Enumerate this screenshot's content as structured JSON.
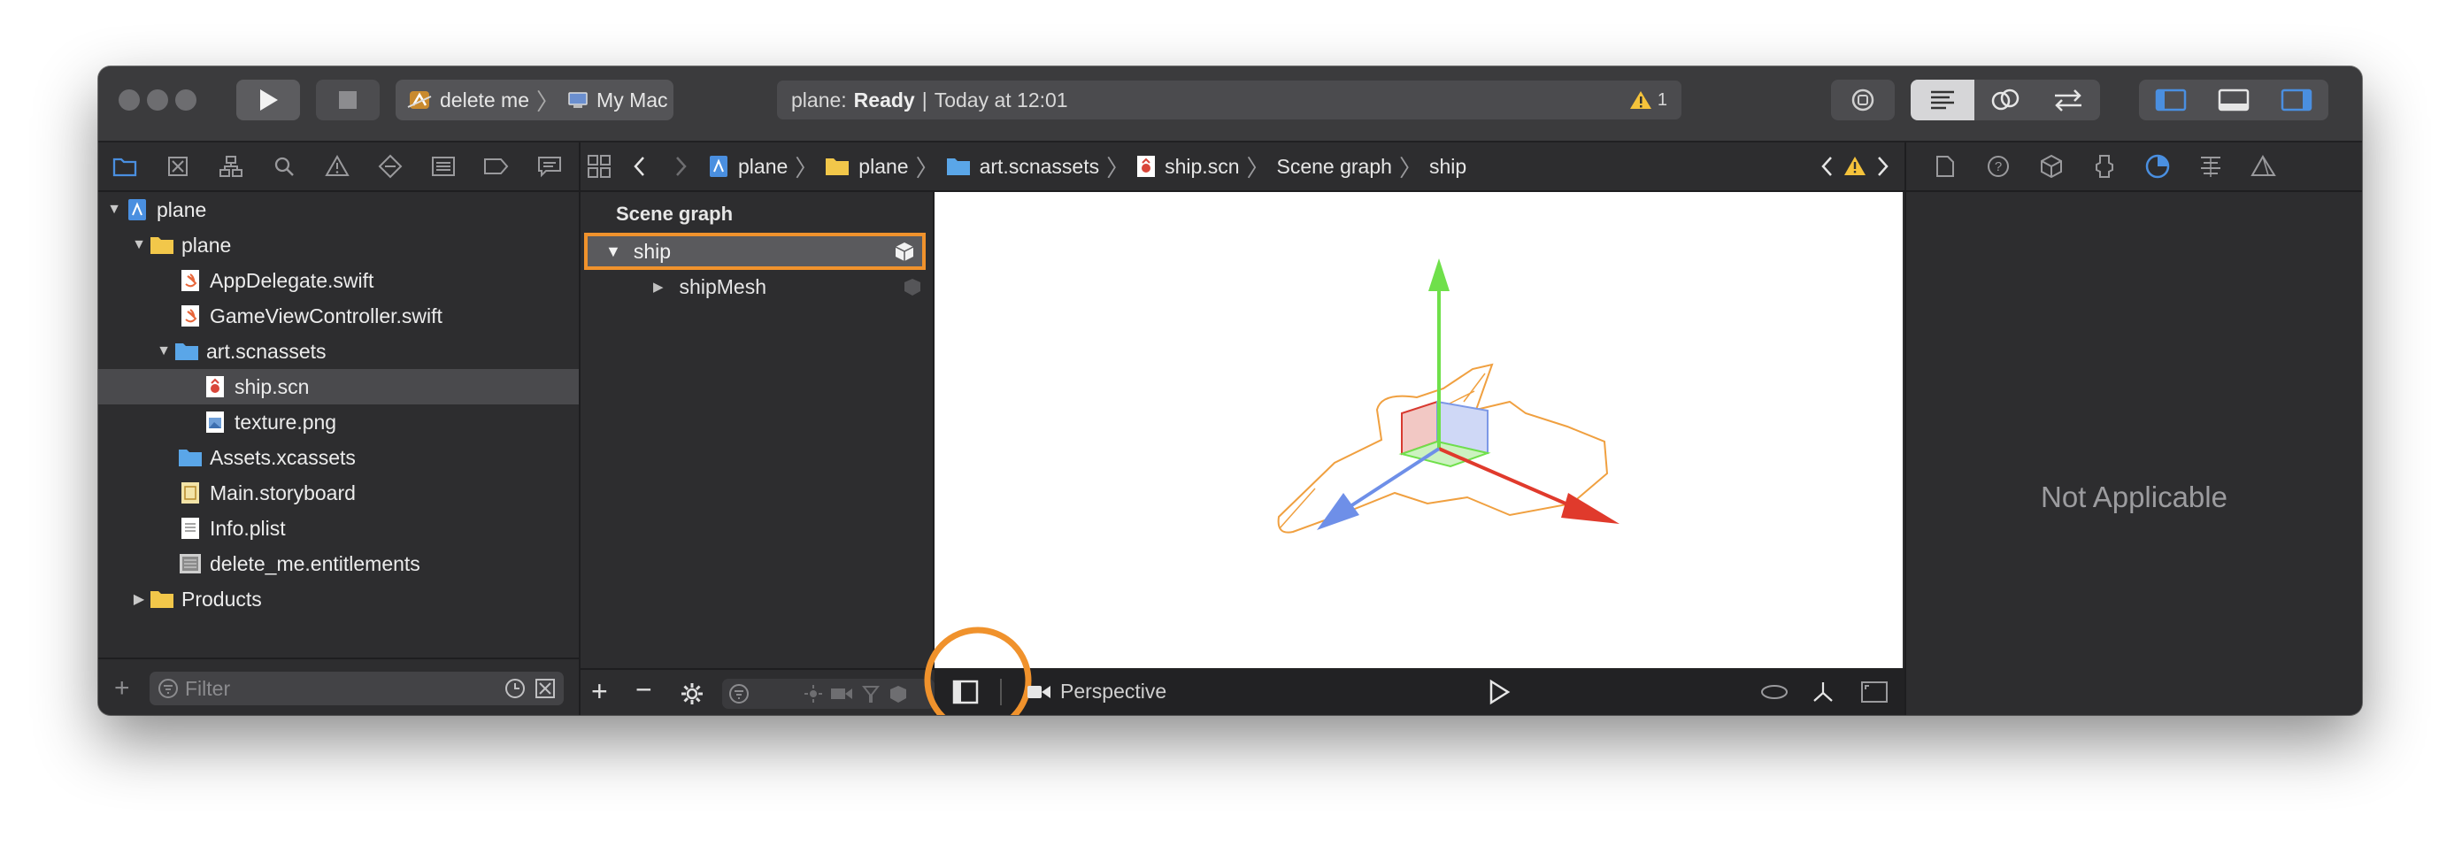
{
  "toolbar": {
    "run_icon": "play-icon",
    "stop_icon": "stop-icon",
    "scheme_name": "delete me",
    "destination": "My Mac",
    "activity": {
      "project": "plane:",
      "status": "Ready",
      "separator": "|",
      "time": "Today at 12:01",
      "warning_count": "1"
    }
  },
  "navigator": {
    "tree": [
      {
        "label": "plane",
        "kind": "project"
      },
      {
        "label": "plane",
        "kind": "folder"
      },
      {
        "label": "AppDelegate.swift",
        "kind": "swift"
      },
      {
        "label": "GameViewController.swift",
        "kind": "swift"
      },
      {
        "label": "art.scnassets",
        "kind": "blue-folder"
      },
      {
        "label": "ship.scn",
        "kind": "scene"
      },
      {
        "label": "texture.png",
        "kind": "image"
      },
      {
        "label": "Assets.xcassets",
        "kind": "blue-folder"
      },
      {
        "label": "Main.storyboard",
        "kind": "storyboard"
      },
      {
        "label": "Info.plist",
        "kind": "plist"
      },
      {
        "label": "delete_me.entitlements",
        "kind": "entitlements"
      },
      {
        "label": "Products",
        "kind": "folder"
      }
    ],
    "filter_placeholder": "Filter"
  },
  "jumpbar": {
    "crumbs": [
      "plane",
      "plane",
      "art.scnassets",
      "ship.scn",
      "Scene graph",
      "ship"
    ]
  },
  "scene_graph": {
    "title": "Scene graph",
    "nodes": [
      {
        "label": "ship",
        "selected": true
      },
      {
        "label": "shipMesh",
        "selected": false
      }
    ]
  },
  "viewport": {
    "camera_label": "Perspective"
  },
  "inspector": {
    "empty_text": "Not Applicable"
  },
  "colors": {
    "highlight_orange": "#f0922c",
    "axis_x": "#e03a2c",
    "axis_y": "#6fe04a",
    "axis_z": "#6e8fe8",
    "accent_blue": "#4a8fe0"
  }
}
